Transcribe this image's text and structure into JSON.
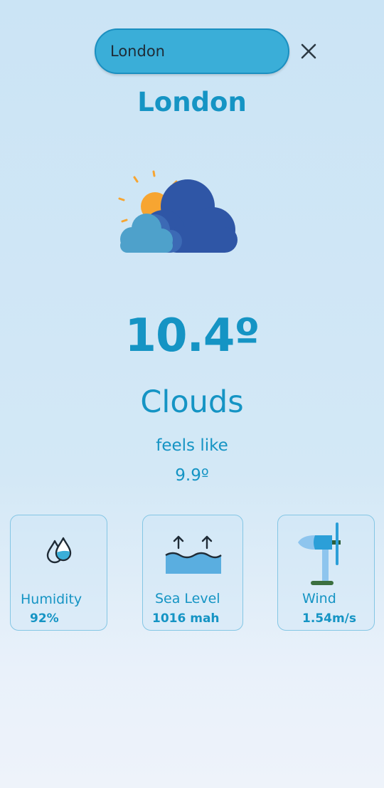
{
  "search": {
    "value": "London",
    "placeholder": ""
  },
  "city": "London",
  "weather": {
    "icon": "sun-behind-clouds-icon",
    "temperature": "10.4º",
    "condition": "Clouds",
    "feels_like_label": "feels like",
    "feels_like_value": "9.9º"
  },
  "cards": [
    {
      "icon": "humidity-drops-icon",
      "label": "Humidity",
      "value": "92%"
    },
    {
      "icon": "sea-level-icon",
      "label": "Sea Level",
      "value": "1016 mah"
    },
    {
      "icon": "wind-turbine-icon",
      "label": "Wind",
      "value": "1.54m/s"
    }
  ],
  "colors": {
    "accent": "#1594c4",
    "search_bg": "#3aaed8",
    "cloud_dark": "#2f56a6",
    "cloud_light": "#4ea1cb",
    "sun": "#f7a531"
  }
}
